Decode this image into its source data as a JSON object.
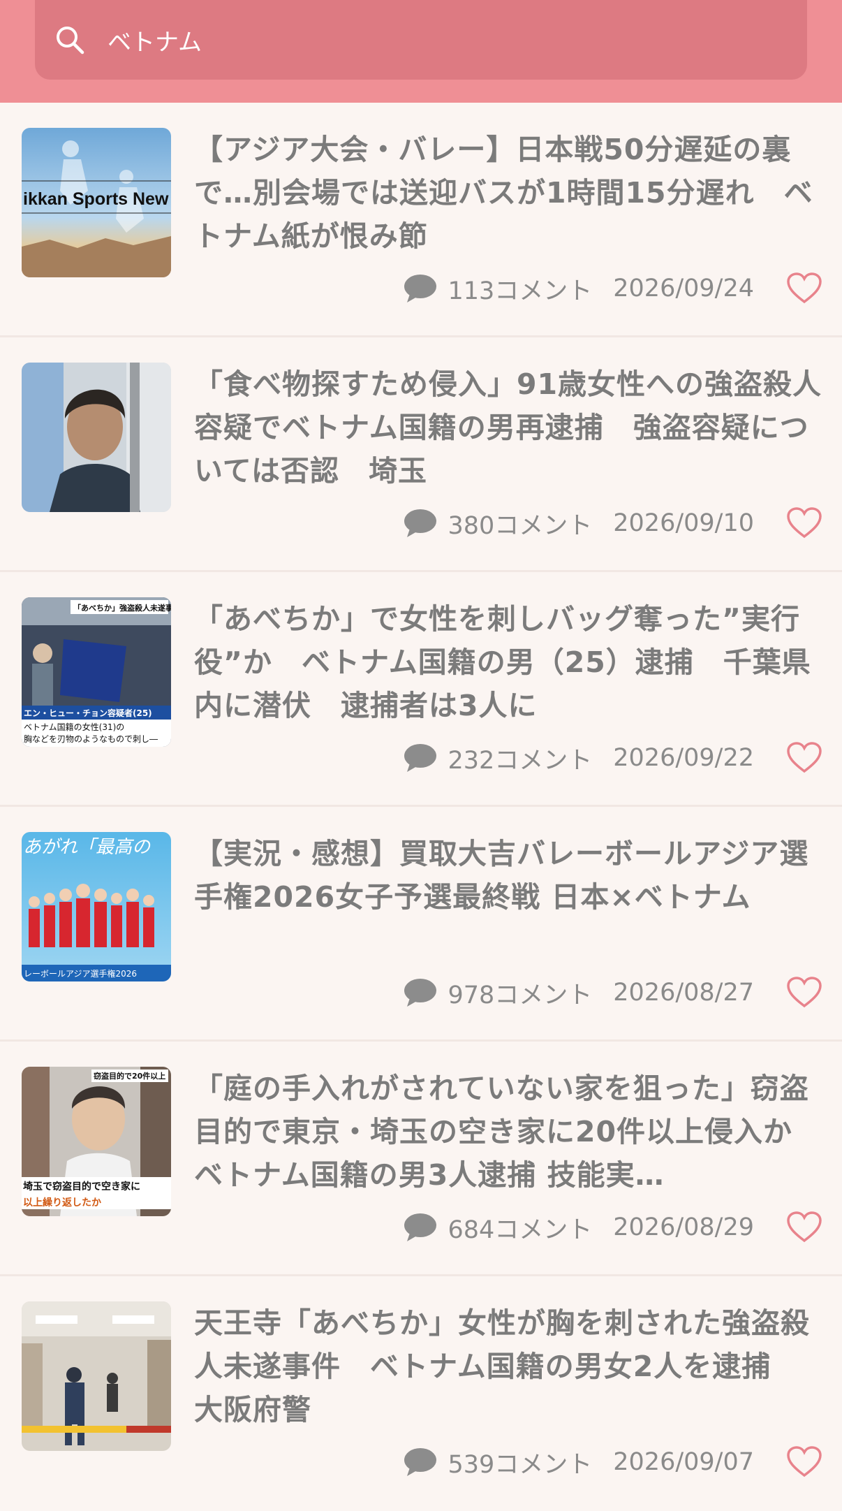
{
  "search": {
    "value": "ベトナム",
    "icon": "search-icon"
  },
  "articles": [
    {
      "title": "【アジア大会・バレー】日本戦50分遅延の裏で…別会場では送迎バスが1時間15分遅れ　ベトナム紙が恨み節",
      "comments": "113コメント",
      "date": "2026/09/24",
      "thumb_text": "ikkan Sports New"
    },
    {
      "title": "「食べ物探すため侵入」91歳女性への強盗殺人容疑でベトナム国籍の男再逮捕　強盗容疑については否認　埼玉",
      "comments": "380コメント",
      "date": "2026/09/10"
    },
    {
      "title": "「あべちか」で女性を刺しバッグ奪った”実行役”か　ベトナム国籍の男（25）逮捕　千葉県内に潜伏　逮捕者は3人に",
      "comments": "232コメント",
      "date": "2026/09/22",
      "thumb_text": "「あべちか」強盗殺人未遂事件",
      "thumb_caption1": "エン・ヒュー・チョン容疑者(25)",
      "thumb_caption2": "ベトナム国籍の女性(31)の",
      "thumb_caption3": "胸などを刃物のようなもので刺し―"
    },
    {
      "title": "【実況・感想】買取大吉バレーボールアジア選手権2026女子予選最終戦 日本×ベトナム",
      "comments": "978コメント",
      "date": "2026/08/27",
      "thumb_text": "あがれ「最高の",
      "thumb_caption1": "レーボールアジア選手権2026"
    },
    {
      "title": "「庭の手入れがされていない家を狙った」窃盗目的で東京・埼玉の空き家に20件以上侵入か ベトナム国籍の男3人逮捕 技能実…",
      "comments": "684コメント",
      "date": "2026/08/29",
      "thumb_text": "窃盗目的で20件以上",
      "thumb_caption1": "埼玉で窃盗目的で空き家に",
      "thumb_caption2": "以上繰り返したか"
    },
    {
      "title": "天王寺「あべちか」女性が胸を刺された強盗殺人未遂事件　ベトナム国籍の男女2人を逮捕　大阪府警",
      "comments": "539コメント",
      "date": "2026/09/07"
    }
  ],
  "colors": {
    "header": "#ef8f95",
    "search_bg": "#dd7a82",
    "background": "#fbf5f2",
    "text": "#7b7b7b",
    "heart": "#e8838c"
  }
}
